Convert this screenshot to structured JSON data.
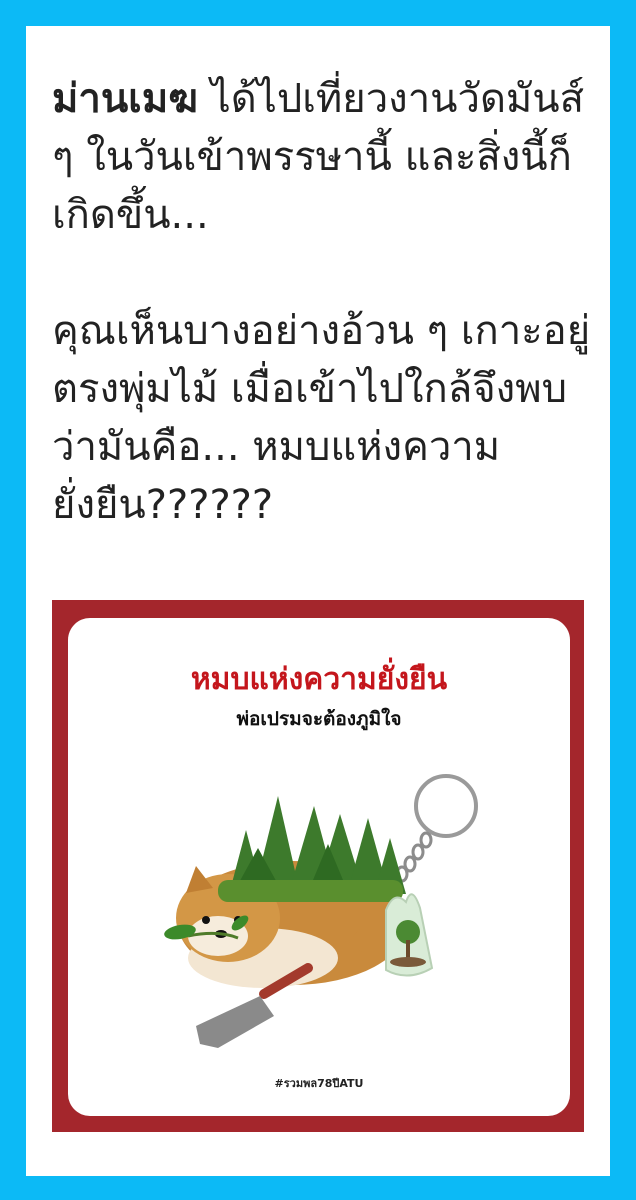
{
  "post": {
    "author": "ม่านเมฆ",
    "line1_rest": " ได้ไปเที่ยวงานวัดมันส์ ๆ ในวันเข้าพรรษานี้ และสิ่งนี้ก็เกิดขึ้น...",
    "paragraph2": "คุณเห็นบางอย่างอ้วน ๆ เกาะอยู่ตรงพุ่มไม้ เมื่อเข้าไปใกล้จึงพบว่ามันคือ... หมบแห่งความยั่งยืน??????"
  },
  "image": {
    "title": "หมบแห่งความยั่งยืน",
    "subtitle": "พ่อเปรมจะต้องภูมิใจ",
    "hashtag": "#รวมพล78ปีATU",
    "colors": {
      "frame": "#a4262c",
      "title": "#c4161c",
      "background": "#0cbaf6"
    }
  }
}
